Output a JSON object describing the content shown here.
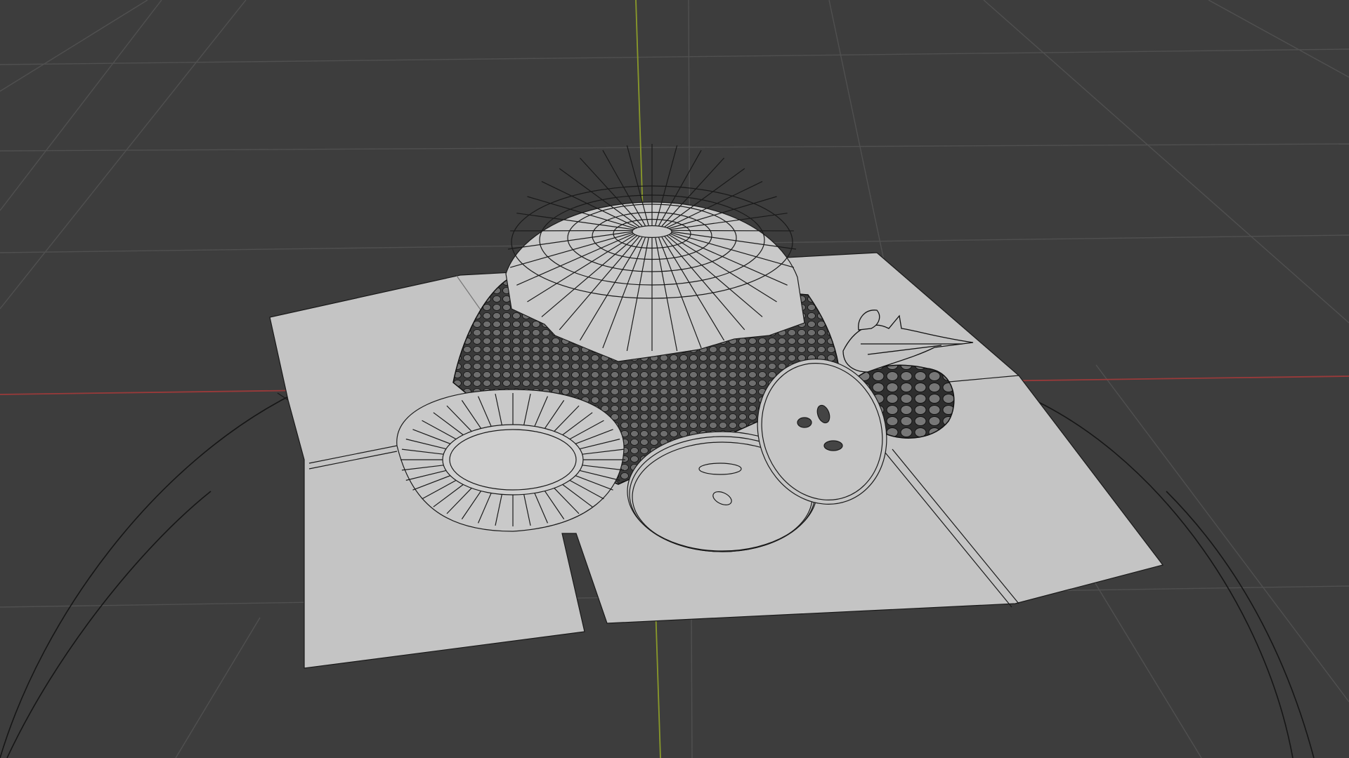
{
  "viewport": {
    "background_color": "#3d3d3d",
    "grid_color": "#505050",
    "x_axis_color": "#9a3a3a",
    "y_axis_color": "#8a9a2a",
    "mesh_face_color": "#c4c4c4",
    "wire_color": "#111111",
    "shading_mode": "wireframe-overlay",
    "objects": [
      {
        "name": "cloth",
        "kind": "folded-cloth"
      },
      {
        "name": "bowl",
        "kind": "bowl"
      },
      {
        "name": "bread-loaf",
        "kind": "textured-loaf"
      },
      {
        "name": "grapes",
        "kind": "grape-bunch"
      },
      {
        "name": "bird",
        "kind": "bird-figurine"
      },
      {
        "name": "bread-slice-left",
        "kind": "slice"
      },
      {
        "name": "bread-slice-middle",
        "kind": "slice"
      },
      {
        "name": "bread-slice-right",
        "kind": "slice"
      }
    ]
  }
}
